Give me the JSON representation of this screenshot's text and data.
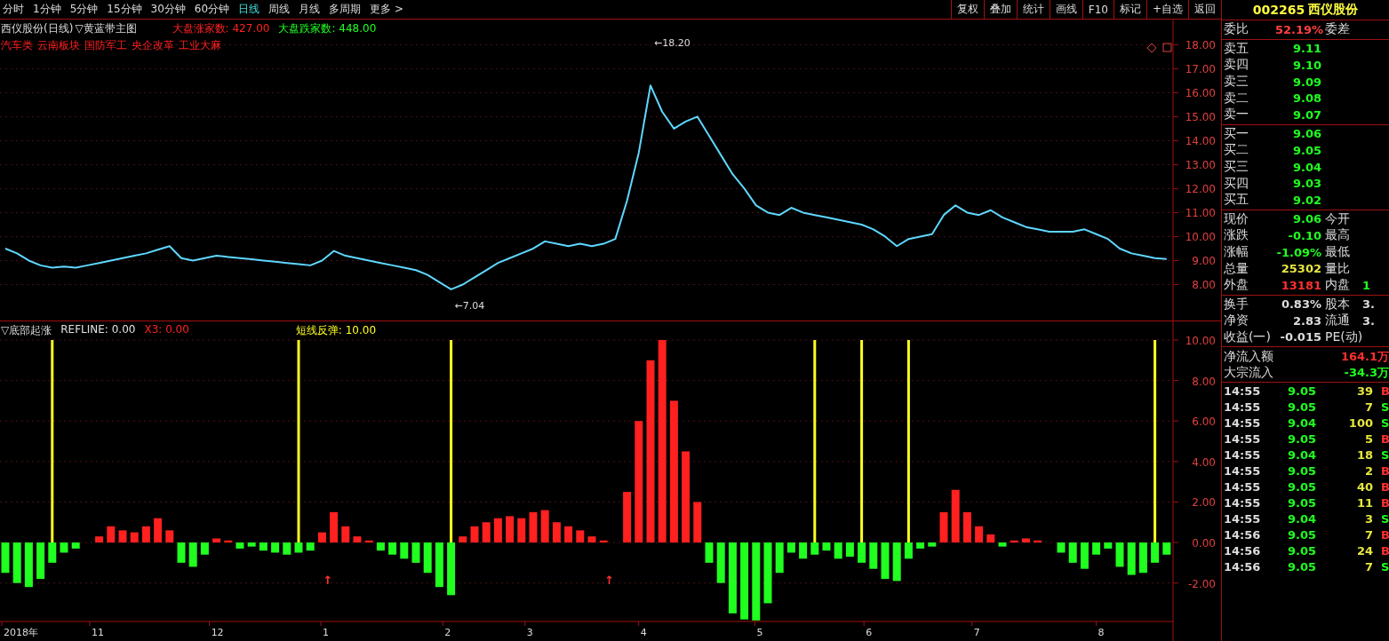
{
  "toolbar": {
    "periods": [
      {
        "label": "分时",
        "selected": false
      },
      {
        "label": "1分钟",
        "selected": false
      },
      {
        "label": "5分钟",
        "selected": false
      },
      {
        "label": "15分钟",
        "selected": false
      },
      {
        "label": "30分钟",
        "selected": false
      },
      {
        "label": "60分钟",
        "selected": false
      },
      {
        "label": "日线",
        "selected": true
      },
      {
        "label": "周线",
        "selected": false
      },
      {
        "label": "月线",
        "selected": false
      },
      {
        "label": "多周期",
        "selected": false
      },
      {
        "label": "更多 >",
        "selected": false
      }
    ],
    "buttons": [
      "复权",
      "叠加",
      "统计",
      "画线",
      "F10",
      "标记",
      "+自选",
      "返回"
    ]
  },
  "main_panel": {
    "title": "西仪股份(日线)",
    "indicator": "▽黄蓝带主图",
    "legend": [
      {
        "label": "大盘涨家数: 427.00",
        "color": "#ff2020"
      },
      {
        "label": "大盘跌家数: 448.00",
        "color": "#20ff20"
      }
    ],
    "sectors": [
      "汽车类",
      "云南板块",
      "国防军工",
      "央企改革",
      "工业大麻"
    ],
    "chart_data": {
      "type": "line",
      "grid": true,
      "ylim": [
        6.5,
        19.05
      ],
      "yticks": [
        {
          "value": 8,
          "label": "8.00"
        },
        {
          "value": 9,
          "label": "9.00"
        },
        {
          "value": 10,
          "label": "10.00"
        },
        {
          "value": 11,
          "label": "11.00"
        },
        {
          "value": 12,
          "label": "12.00"
        },
        {
          "value": 13,
          "label": "13.00"
        },
        {
          "value": 14,
          "label": "14.00"
        },
        {
          "value": 15,
          "label": "15.00"
        },
        {
          "value": 16,
          "label": "16.00"
        },
        {
          "value": 17,
          "label": "17.00"
        },
        {
          "value": 18,
          "label": "18.00"
        }
      ],
      "series": [
        {
          "color": "#5fd7ff",
          "values": [
            9.5,
            9.3,
            9.0,
            8.8,
            8.7,
            8.75,
            8.7,
            8.8,
            8.9,
            9.0,
            9.1,
            9.2,
            9.3,
            9.45,
            9.6,
            9.1,
            9.0,
            9.1,
            9.2,
            9.15,
            9.1,
            9.05,
            9.0,
            8.95,
            8.9,
            8.85,
            8.8,
            9.0,
            9.4,
            9.2,
            9.1,
            9.0,
            8.9,
            8.8,
            8.7,
            8.6,
            8.4,
            8.1,
            7.8,
            8.0,
            8.3,
            8.6,
            8.9,
            9.1,
            9.3,
            9.5,
            9.8,
            9.7,
            9.6,
            9.7,
            9.6,
            9.7,
            9.9,
            11.5,
            13.5,
            16.3,
            15.2,
            14.5,
            14.8,
            15.0,
            14.2,
            13.4,
            12.6,
            12.0,
            11.3,
            11.0,
            10.9,
            11.2,
            11.0,
            10.9,
            10.8,
            10.7,
            10.6,
            10.5,
            10.3,
            10.0,
            9.6,
            9.9,
            10.0,
            10.1,
            10.9,
            11.3,
            11.0,
            10.9,
            11.1,
            10.8,
            10.6,
            10.4,
            10.3,
            10.2,
            10.2,
            10.2,
            10.3,
            10.1,
            9.9,
            9.5,
            9.3,
            9.2,
            9.1,
            9.06
          ]
        }
      ],
      "annotations": [
        "←18.20",
        "←7.04"
      ]
    }
  },
  "indicator_panel": {
    "title": "▽底部起涨",
    "legend": [
      {
        "label": "REFLINE: 0.00",
        "color": "#e0e0e0"
      },
      {
        "label": "X3: 0.00",
        "color": "#ff2020"
      },
      {
        "label": "短线反弹: 10.00",
        "color": "#ffff20"
      }
    ],
    "date_axis": [
      "2018年",
      "11",
      "12",
      "1",
      "2",
      "3",
      "4",
      "5",
      "6",
      "7",
      "8"
    ],
    "chart_data": {
      "type": "bar",
      "grid": true,
      "ylim": [
        -3.9,
        10.92
      ],
      "yticks": [
        {
          "value": -2,
          "label": "-2.00"
        },
        {
          "value": 0,
          "label": "0.00"
        },
        {
          "value": 2,
          "label": "2.00"
        },
        {
          "value": 4,
          "label": "4.00"
        },
        {
          "value": 6,
          "label": "6.00"
        },
        {
          "value": 8,
          "label": "8.00"
        },
        {
          "value": 10,
          "label": "10.00"
        }
      ],
      "series": [
        {
          "color": "#ff2020",
          "values": [
            null,
            null,
            null,
            null,
            null,
            null,
            null,
            null,
            0.3,
            0.8,
            0.6,
            0.5,
            0.8,
            1.2,
            0.6,
            null,
            null,
            null,
            0.2,
            0.1,
            null,
            null,
            null,
            null,
            null,
            null,
            null,
            0.5,
            1.5,
            0.8,
            0.3,
            0.1,
            null,
            null,
            null,
            null,
            null,
            null,
            null,
            0.3,
            0.8,
            1,
            1.2,
            1.3,
            1.2,
            1.5,
            1.6,
            1,
            0.8,
            0.6,
            0.3,
            0.1,
            null,
            2.5,
            6,
            9,
            10,
            7,
            4.5,
            2,
            null,
            null,
            null,
            null,
            null,
            null,
            null,
            null,
            null,
            null,
            null,
            null,
            null,
            null,
            null,
            null,
            null,
            null,
            null,
            null,
            1.5,
            2.6,
            1.5,
            0.8,
            0.4,
            null,
            0.1,
            0.2,
            0.1,
            null,
            null,
            null,
            null,
            null,
            null,
            null,
            null,
            null,
            null,
            null
          ]
        },
        {
          "color": "#20ff20",
          "values": [
            -1.5,
            -2,
            -2.2,
            -1.8,
            -1,
            -0.5,
            -0.3,
            null,
            null,
            null,
            null,
            null,
            null,
            null,
            null,
            -1,
            -1.2,
            -0.6,
            null,
            null,
            -0.3,
            -0.2,
            -0.4,
            -0.5,
            -0.6,
            -0.5,
            -0.4,
            null,
            null,
            null,
            null,
            null,
            -0.4,
            -0.6,
            -0.8,
            -1,
            -1.5,
            -2.2,
            -2.6,
            null,
            null,
            null,
            null,
            null,
            null,
            null,
            null,
            null,
            null,
            null,
            null,
            null,
            null,
            null,
            null,
            null,
            null,
            null,
            null,
            null,
            -1,
            -2,
            -3.5,
            -3.8,
            -3.85,
            -3,
            -1.5,
            -0.5,
            -0.8,
            -0.6,
            -0.4,
            -0.8,
            -0.7,
            -1,
            -1.3,
            -1.8,
            -1.9,
            -0.8,
            -0.3,
            -0.2,
            null,
            null,
            null,
            null,
            null,
            -0.2,
            null,
            null,
            null,
            null,
            -0.5,
            -1,
            -1.3,
            -0.6,
            -0.3,
            -1.2,
            -1.6,
            -1.5,
            -1,
            -0.6
          ]
        },
        {
          "color": "#ffff20",
          "values": [
            null,
            null,
            null,
            null,
            10,
            null,
            null,
            null,
            null,
            null,
            null,
            null,
            null,
            null,
            null,
            null,
            null,
            null,
            null,
            null,
            null,
            null,
            null,
            null,
            null,
            10,
            null,
            null,
            null,
            null,
            null,
            null,
            null,
            null,
            null,
            null,
            null,
            null,
            10,
            null,
            null,
            null,
            null,
            null,
            null,
            null,
            null,
            null,
            null,
            null,
            null,
            null,
            null,
            null,
            null,
            null,
            null,
            null,
            null,
            null,
            null,
            null,
            null,
            null,
            null,
            null,
            null,
            null,
            null,
            10,
            null,
            null,
            null,
            10,
            null,
            null,
            null,
            10,
            null,
            null,
            null,
            null,
            null,
            null,
            null,
            null,
            null,
            null,
            null,
            null,
            null,
            null,
            null,
            null,
            null,
            null,
            null,
            null,
            10,
            null
          ]
        }
      ],
      "annotations": [
        "↑",
        "↑"
      ]
    }
  },
  "quote": {
    "code": "002265",
    "name": "西仪股份"
  },
  "order_ratio": {
    "label": "委比",
    "value": "52.19%",
    "label2": "委差"
  },
  "asks": [
    {
      "label": "卖五",
      "price": "9.11"
    },
    {
      "label": "卖四",
      "price": "9.10"
    },
    {
      "label": "卖三",
      "price": "9.09"
    },
    {
      "label": "卖二",
      "price": "9.08"
    },
    {
      "label": "卖一",
      "price": "9.07"
    }
  ],
  "bids": [
    {
      "label": "买一",
      "price": "9.06"
    },
    {
      "label": "买二",
      "price": "9.05"
    },
    {
      "label": "买三",
      "price": "9.04"
    },
    {
      "label": "买四",
      "price": "9.03"
    },
    {
      "label": "买五",
      "price": "9.02"
    }
  ],
  "stats": [
    {
      "label": "现价",
      "value": "9.06",
      "color": "#20ff20",
      "label2": "今开"
    },
    {
      "label": "涨跌",
      "value": "-0.10",
      "color": "#20ff20",
      "label2": "最高"
    },
    {
      "label": "涨幅",
      "value": "-1.09%",
      "color": "#20ff20",
      "label2": "最低"
    },
    {
      "label": "总量",
      "value": "25302",
      "color": "#e6e640",
      "label2": "量比"
    },
    {
      "label": "外盘",
      "value": "13181",
      "color": "#ff3030",
      "label2": "内盘",
      "value2": "1"
    }
  ],
  "finance": [
    {
      "label": "换手",
      "value": "0.83%",
      "label2": "股本",
      "value2": "3."
    },
    {
      "label": "净资",
      "value": "2.83",
      "label2": "流通",
      "value2": "3."
    },
    {
      "label": "收益(一)",
      "value": "-0.015",
      "label2": "PE(动)"
    }
  ],
  "flows": [
    {
      "label": "净流入额",
      "value": "164.1万",
      "color": "#ff3030"
    },
    {
      "label": "大宗流入",
      "value": "-34.3万",
      "color": "#20ff20"
    }
  ],
  "trades": [
    {
      "time": "14:55",
      "price": "9.05",
      "volume": "39",
      "side": "B"
    },
    {
      "time": "14:55",
      "price": "9.05",
      "volume": "7",
      "side": "S"
    },
    {
      "time": "14:55",
      "price": "9.04",
      "volume": "100",
      "side": "S"
    },
    {
      "time": "14:55",
      "price": "9.05",
      "volume": "5",
      "side": "B"
    },
    {
      "time": "14:55",
      "price": "9.04",
      "volume": "18",
      "side": "S"
    },
    {
      "time": "14:55",
      "price": "9.05",
      "volume": "2",
      "side": "B"
    },
    {
      "time": "14:55",
      "price": "9.05",
      "volume": "40",
      "side": "B"
    },
    {
      "time": "14:55",
      "price": "9.05",
      "volume": "11",
      "side": "B"
    },
    {
      "time": "14:55",
      "price": "9.04",
      "volume": "3",
      "side": "S"
    },
    {
      "time": "14:56",
      "price": "9.05",
      "volume": "7",
      "side": "B"
    },
    {
      "time": "14:56",
      "price": "9.05",
      "volume": "24",
      "side": "B"
    },
    {
      "time": "14:56",
      "price": "9.05",
      "volume": "7",
      "side": "S"
    }
  ]
}
